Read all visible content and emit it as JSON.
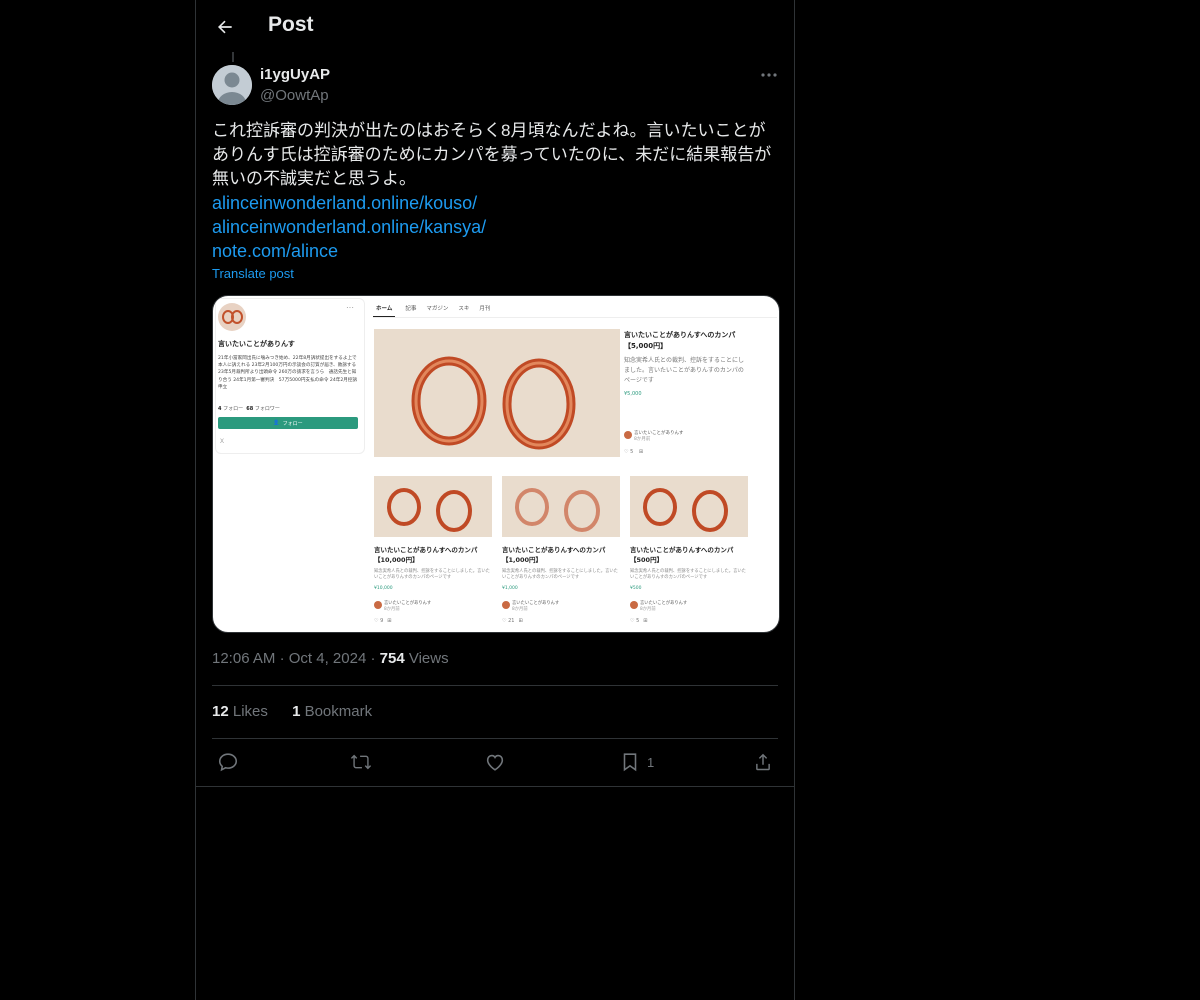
{
  "header": {
    "title": "Post"
  },
  "author": {
    "name": "i1ygUyAP",
    "handle": "@OowtAp"
  },
  "post": {
    "text": "これ控訴審の判決が出たのはおそらく8月頃なんだよね。言いたいことがありんす氏は控訴審のためにカンパを募っていたのに、未だに結果報告が無いの不誠実だと思うよ。",
    "links": [
      "alinceinwonderland.online/kouso/",
      "alinceinwonderland.online/kansya/",
      "note.com/alince"
    ],
    "translate_label": "Translate post"
  },
  "media": {
    "profile": {
      "name": "言いたいことがありんす",
      "bio": "21年小冨家岡出氏に噛みつき始め、22年8月訴状提出をするよ上で本人に訴えれる 23年2月100万円の示談会の訂質が届き、敗訴する 23年5月裁判所より出頭命令 260万の請求を言うら　通話先生と知り合う 24年1月第一審判決　57万5000円支払の命令 24年2月控訴申立",
      "following_count": "4",
      "following_label": "フォロー",
      "followers_count": "68",
      "followers_label": "フォロワー",
      "follow_button": "フォロー"
    },
    "tabs": [
      "ホーム",
      "記事",
      "マガジン",
      "スキ",
      "月刊"
    ],
    "feature": {
      "title": "言いたいことがありんすへのカンパ【5,000円】",
      "desc": "知念実希人氏との裁判、控訴をすることにしました。言いたいことがありんすのカンパのページです",
      "price": "¥5,000",
      "author": "言いたいことがありんす",
      "date": "8か月前",
      "likes": "5"
    },
    "cards": [
      {
        "title": "言いたいことがありんすへのカンパ【10,000円】",
        "desc": "知念実希人氏との裁判、控訴をすることにしました。言いたいことがありんすのカンパのページです",
        "price": "¥10,000",
        "author": "言いたいことがありんす",
        "date": "8か月前",
        "likes": "9"
      },
      {
        "title": "言いたいことがありんすへのカンパ【1,000円】",
        "desc": "知念実希人氏との裁判、控訴をすることにしました。言いたいことがありんすのカンパのページです",
        "price": "¥1,000",
        "author": "言いたいことがありんす",
        "date": "8か月前",
        "likes": "21"
      },
      {
        "title": "言いたいことがありんすへのカンパ【500円】",
        "desc": "知念実希人氏との裁判、控訴をすることにしました。言いたいことがありんすのカンパのページです",
        "price": "¥500",
        "author": "言いたいことがありんす",
        "date": "8か月前",
        "likes": "5"
      }
    ]
  },
  "meta": {
    "time": "12:06 AM",
    "date": "Oct 4, 2024",
    "views_count": "754",
    "views_label": "Views"
  },
  "stats": {
    "likes_count": "12",
    "likes_label": "Likes",
    "bookmarks_count": "1",
    "bookmarks_label": "Bookmark"
  },
  "actions": {
    "bookmark_count": "1"
  },
  "colors": {
    "background": "#000000",
    "link": "#1d9bf0",
    "secondary_text": "#71767b",
    "note_green": "#2b9a7e"
  }
}
